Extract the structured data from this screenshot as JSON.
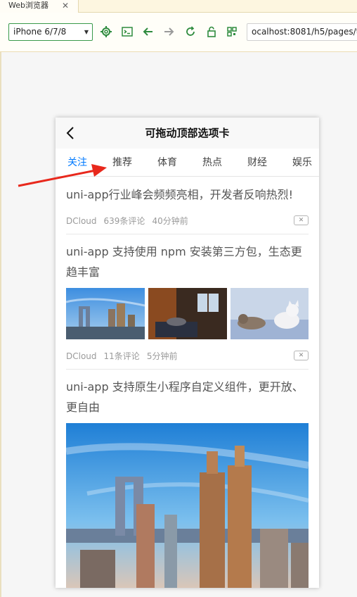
{
  "ide": {
    "tab_label": "Web浏览器",
    "tab_close": "✕"
  },
  "toolbar": {
    "device": "iPhone 6/7/8",
    "url": "ocalhost:8081/h5/pages/t",
    "accent": "#2e8b3e"
  },
  "page": {
    "nav_title": "可拖动顶部选项卡",
    "tabs": [
      "关注",
      "推荐",
      "体育",
      "热点",
      "财经",
      "娱乐"
    ],
    "active_tab": "关注",
    "active_color": "#007aff"
  },
  "news": [
    {
      "title": "uni-app行业峰会频频亮相，开发者反响热烈!",
      "source": "DCloud",
      "comments": "639条评论",
      "time": "40分钟前"
    },
    {
      "title": "uni-app 支持使用 npm 安装第三方包，生态更趋丰富",
      "source": "DCloud",
      "comments": "11条评论",
      "time": "5分钟前",
      "images": [
        "city-skyline-photo",
        "room-interior-photo",
        "kittens-photo"
      ]
    },
    {
      "title": "uni-app 支持原生小程序自定义组件，更开放、更自由",
      "image": "city-towers-photo"
    }
  ],
  "annotation": {
    "arrow_color": "#e8281c"
  }
}
